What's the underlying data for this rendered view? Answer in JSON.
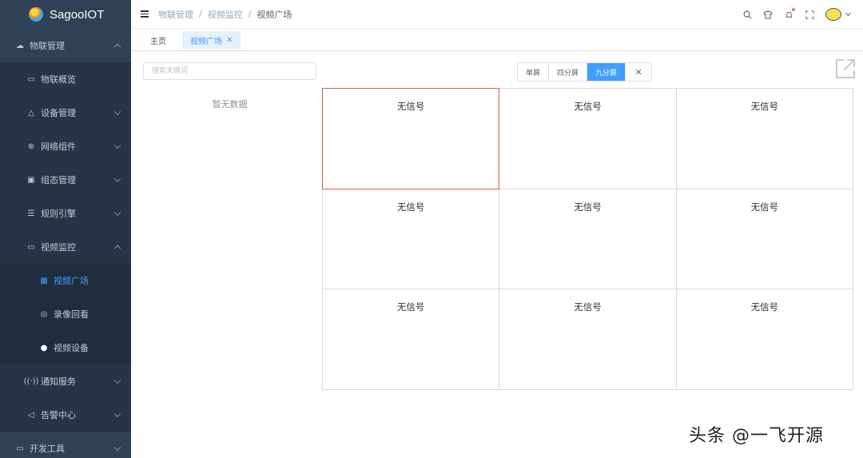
{
  "app": {
    "title": "SagooIOT"
  },
  "sidebar": {
    "items": [
      {
        "label": "物联管理",
        "icon": "iot-icon",
        "level": 0,
        "arrow": "up"
      },
      {
        "label": "物联概览",
        "icon": "monitor-icon",
        "level": 1
      },
      {
        "label": "设备管理",
        "icon": "device-icon",
        "level": 1,
        "arrow": "down"
      },
      {
        "label": "网络组件",
        "icon": "network-icon",
        "level": 1,
        "arrow": "down"
      },
      {
        "label": "组态管理",
        "icon": "config-icon",
        "level": 1,
        "arrow": "down"
      },
      {
        "label": "规则引擎",
        "icon": "rule-icon",
        "level": 1,
        "arrow": "down"
      },
      {
        "label": "视频监控",
        "icon": "video-icon",
        "level": 1,
        "arrow": "up"
      },
      {
        "label": "视频广场",
        "icon": "grid-icon",
        "level": 2,
        "active": true
      },
      {
        "label": "录像回看",
        "icon": "playback-icon",
        "level": 2
      },
      {
        "label": "视频设备",
        "icon": "camera-dot-icon",
        "level": 2
      },
      {
        "label": "通知服务",
        "icon": "broadcast-icon",
        "level": 1,
        "arrow": "down"
      },
      {
        "label": "告警中心",
        "icon": "alarm-icon",
        "level": 1,
        "arrow": "down"
      },
      {
        "label": "开发工具",
        "icon": "dev-icon",
        "level": 0,
        "arrow": "down"
      }
    ]
  },
  "header": {
    "breadcrumb": [
      "物联管理",
      "视频监控",
      "视频广场"
    ],
    "icons": [
      "search-icon",
      "shirt-icon",
      "bell-icon",
      "fullscreen-icon"
    ]
  },
  "tags": [
    {
      "label": "主页",
      "active": false
    },
    {
      "label": "视频广场",
      "active": true
    }
  ],
  "left_panel": {
    "search_placeholder": "搜索关键词",
    "empty_text": "暂无数据"
  },
  "screen_switch": {
    "options": [
      "单屏",
      "四分屏",
      "九分屏"
    ],
    "selected": "九分屏",
    "close": "✕"
  },
  "grid": {
    "cells": [
      "无信号",
      "无信号",
      "无信号",
      "无信号",
      "无信号",
      "无信号",
      "无信号",
      "无信号",
      "无信号"
    ],
    "selected_index": 0,
    "selected_border": "#e05a4e"
  },
  "watermark": "头条 @一飞开源",
  "colors": {
    "accent": "#409eff",
    "sidebar_bg": "#304156"
  }
}
